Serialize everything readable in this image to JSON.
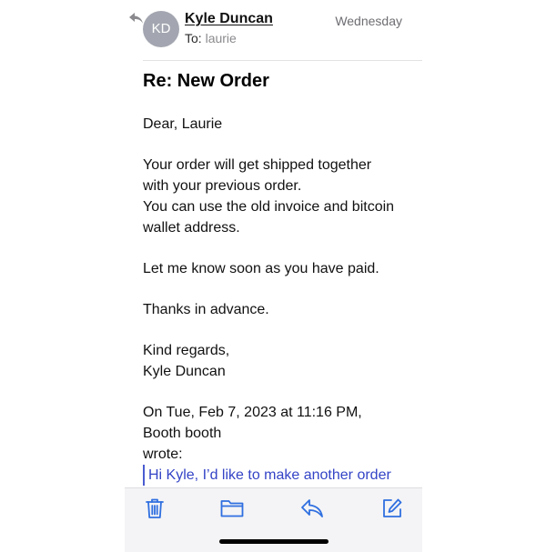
{
  "header": {
    "avatar_initials": "KD",
    "sender_name": "Kyle Duncan",
    "to_label": "To:",
    "recipient": "laurie",
    "date": "Wednesday",
    "reply_indicator_icon": "reply-arrow-icon"
  },
  "subject": "Re: New Order",
  "body": {
    "greeting": "Dear, Laurie",
    "paragraph1_line1": "Your order will get shipped together",
    "paragraph1_line2": "with your previous order.",
    "paragraph1_line3": "You can use the old invoice and bitcoin",
    "paragraph1_line4": "wallet address.",
    "paragraph2": "Let me know soon as you have paid.",
    "paragraph3": "Thanks in advance.",
    "signoff": "Kind regards,",
    "signature": "Kyle Duncan",
    "quote_header_line1": "On Tue, Feb 7, 2023 at 11:16 PM,",
    "quote_header_line2": "Booth booth",
    "quote_header_line3": "wrote:",
    "quoted_text": "Hi Kyle, I’d like to make another order"
  },
  "toolbar": {
    "icons": [
      "trash-icon",
      "folder-icon",
      "reply-icon",
      "compose-icon"
    ],
    "accent_color": "#2f6fe0"
  },
  "colors": {
    "accent": "#2f6fe0",
    "quote": "#3444c6",
    "avatar": "#a3a6b0"
  }
}
